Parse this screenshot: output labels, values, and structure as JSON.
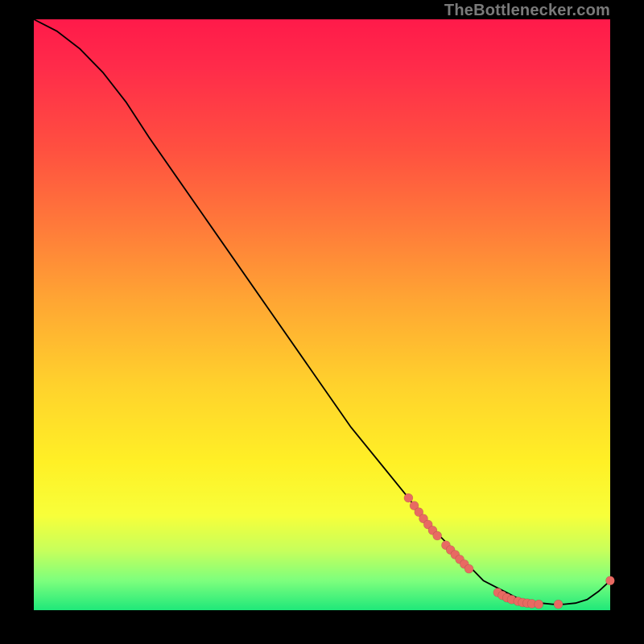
{
  "watermark": "TheBottlenecker.com",
  "colors": {
    "marker": "#e86a62",
    "line": "#000000"
  },
  "chart_data": {
    "type": "line",
    "title": "",
    "xlabel": "",
    "ylabel": "",
    "xlim": [
      0,
      100
    ],
    "ylim": [
      0,
      100
    ],
    "grid": false,
    "series": [
      {
        "name": "curve",
        "x": [
          0,
          4,
          8,
          12,
          16,
          20,
          25,
          30,
          35,
          40,
          45,
          50,
          55,
          60,
          65,
          68,
          70,
          72,
          75,
          78,
          80,
          82,
          84,
          86,
          88,
          90,
          92,
          94,
          96,
          98,
          100
        ],
        "y": [
          100,
          98,
          95,
          91,
          86,
          80,
          73,
          66,
          59,
          52,
          45,
          38,
          31,
          25,
          19,
          15,
          13,
          11,
          8,
          5,
          4,
          3,
          2,
          1.5,
          1.2,
          1,
          1,
          1.2,
          1.8,
          3.2,
          5
        ]
      }
    ],
    "markers": [
      {
        "x": 65.0,
        "y": 19.0
      },
      {
        "x": 66.0,
        "y": 17.7
      },
      {
        "x": 66.8,
        "y": 16.6
      },
      {
        "x": 67.6,
        "y": 15.5
      },
      {
        "x": 68.4,
        "y": 14.5
      },
      {
        "x": 69.2,
        "y": 13.5
      },
      {
        "x": 70.0,
        "y": 12.6
      },
      {
        "x": 71.5,
        "y": 11.0
      },
      {
        "x": 72.3,
        "y": 10.2
      },
      {
        "x": 73.1,
        "y": 9.4
      },
      {
        "x": 73.9,
        "y": 8.6
      },
      {
        "x": 74.7,
        "y": 7.8
      },
      {
        "x": 75.5,
        "y": 7.0
      },
      {
        "x": 80.5,
        "y": 3.0
      },
      {
        "x": 81.3,
        "y": 2.5
      },
      {
        "x": 82.1,
        "y": 2.1
      },
      {
        "x": 82.9,
        "y": 1.8
      },
      {
        "x": 84.0,
        "y": 1.5
      },
      {
        "x": 84.8,
        "y": 1.3
      },
      {
        "x": 85.6,
        "y": 1.2
      },
      {
        "x": 86.4,
        "y": 1.1
      },
      {
        "x": 87.6,
        "y": 1.0
      },
      {
        "x": 91.0,
        "y": 1.0
      },
      {
        "x": 100.0,
        "y": 5.0
      }
    ]
  }
}
